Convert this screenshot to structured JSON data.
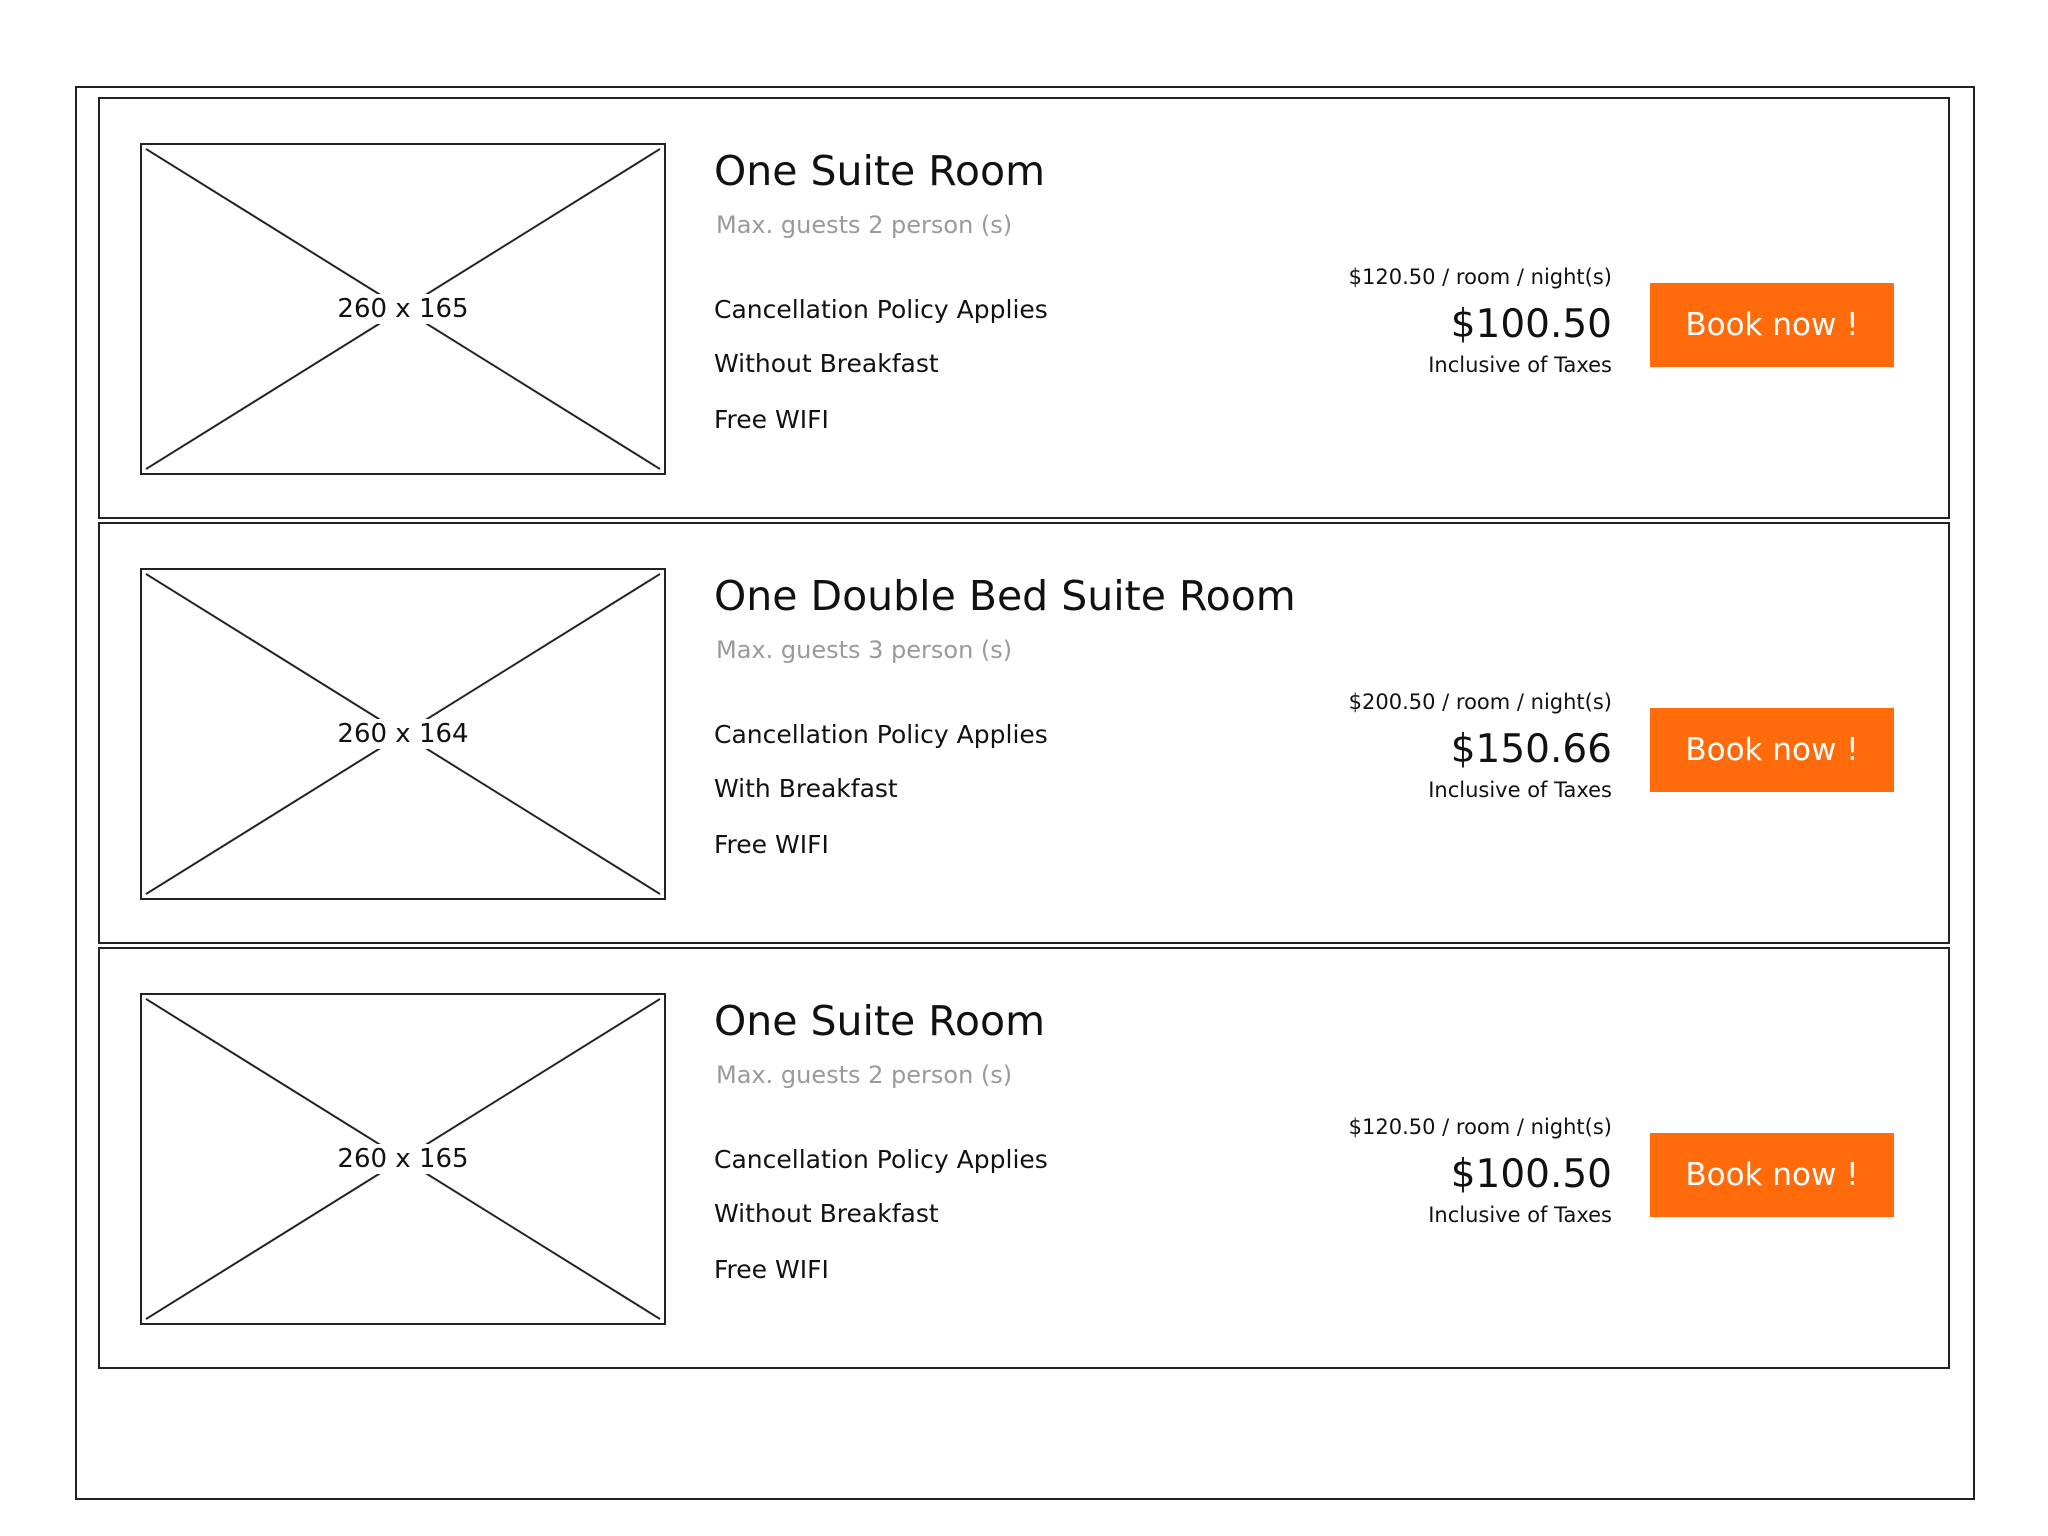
{
  "colors": {
    "accent": "#ff6a0a",
    "muted_text": "#9a9a9a",
    "border": "#222222"
  },
  "rooms": [
    {
      "image_label": "260 x 165",
      "title": "One Suite Room",
      "max_guests": "Max. guests 2 person (s)",
      "features": [
        "Cancellation Policy Applies",
        "Without Breakfast",
        "Free WIFI"
      ],
      "original_price": "$120.50 / room / night(s)",
      "final_price": "$100.50",
      "tax_note": "Inclusive of Taxes",
      "button_label": "Book now !"
    },
    {
      "image_label": "260 x 164",
      "title": "One Double Bed Suite Room",
      "max_guests": "Max. guests 3 person (s)",
      "features": [
        "Cancellation Policy Applies",
        "With Breakfast",
        "Free WIFI"
      ],
      "original_price": "$200.50 / room / night(s)",
      "final_price": "$150.66",
      "tax_note": "Inclusive of Taxes",
      "button_label": "Book now !"
    },
    {
      "image_label": "260 x 165",
      "title": "One Suite Room",
      "max_guests": "Max. guests 2 person (s)",
      "features": [
        "Cancellation Policy Applies",
        "Without Breakfast",
        "Free WIFI"
      ],
      "original_price": "$120.50 / room / night(s)",
      "final_price": "$100.50",
      "tax_note": "Inclusive of Taxes",
      "button_label": "Book now !"
    }
  ]
}
